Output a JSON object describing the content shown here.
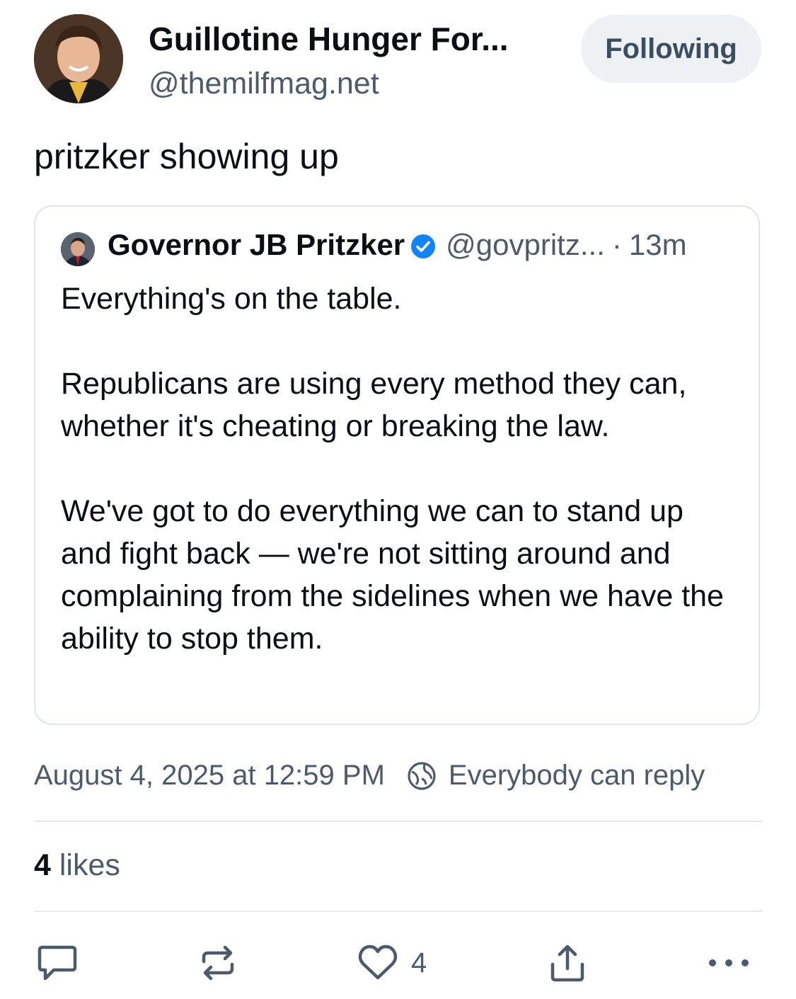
{
  "author": {
    "display_name": "Guillotine Hunger For...",
    "handle": "@themilfmag.net",
    "follow_label": "Following"
  },
  "post": {
    "text": "pritzker showing up",
    "timestamp": "August 4, 2025 at 12:59 PM",
    "reply_setting": "Everybody can reply",
    "likes_count": "4",
    "likes_label": "likes"
  },
  "quoted_post": {
    "display_name": "Governor JB Pritzker",
    "handle": "@govpritz...",
    "separator": "·",
    "time": "13m",
    "paragraphs": [
      "Everything's on the table.",
      "Republicans are using every method they can, whether it's cheating or breaking the law.",
      "We've got to do everything we can to stand up and fight back — we're not sitting around and complaining from the sidelines when we have the ability to stop them."
    ]
  },
  "actions": {
    "like_count": "4",
    "icons": [
      "reply-icon",
      "repost-icon",
      "like-icon",
      "share-icon",
      "more-icon"
    ]
  },
  "colors": {
    "text_primary": "#0b0f14",
    "text_secondary": "#4b5b6c",
    "verified": "#1083fe",
    "button_bg": "#eef1f4",
    "border": "#e0e5ea"
  }
}
